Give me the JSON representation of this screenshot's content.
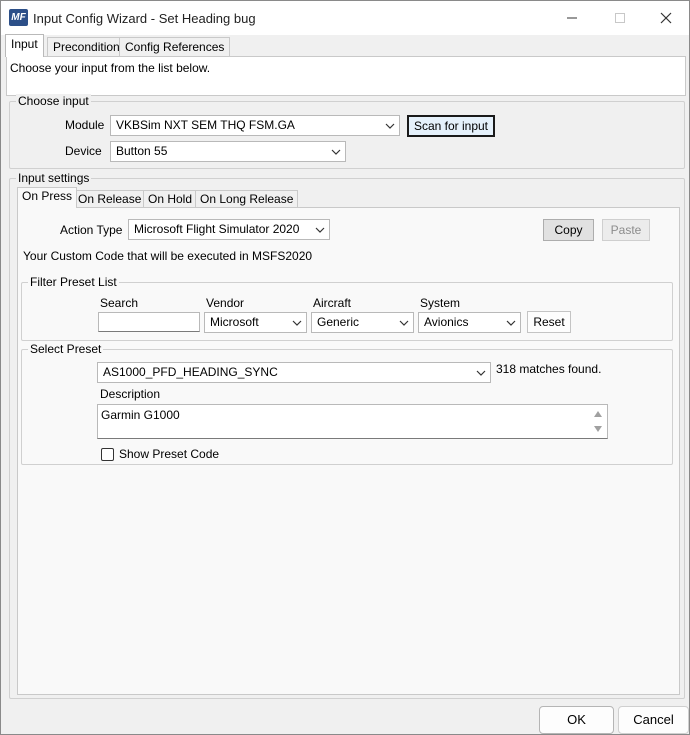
{
  "window": {
    "title": "Input Config Wizard - Set Heading bug",
    "app_icon_text": "MF"
  },
  "tabs": [
    "Input",
    "Precondition",
    "Config References"
  ],
  "instructions": "Choose your input from the list below.",
  "choose_input": {
    "legend": "Choose input",
    "module_label": "Module",
    "module_value": "VKBSim NXT SEM THQ FSM.GA",
    "device_label": "Device",
    "device_value": "Button 55",
    "scan_button": "Scan for input"
  },
  "input_settings": {
    "legend": "Input settings",
    "tabs": [
      "On Press",
      "On Release",
      "On Hold",
      "On Long Release"
    ],
    "action_type_label": "Action Type",
    "action_type_value": "Microsoft Flight Simulator 2020",
    "copy_button": "Copy",
    "paste_button": "Paste",
    "custom_code_note": "Your Custom Code that will be executed in MSFS2020"
  },
  "filter": {
    "legend": "Filter Preset List",
    "search_label": "Search",
    "search_value": "",
    "vendor_label": "Vendor",
    "vendor_value": "Microsoft",
    "aircraft_label": "Aircraft",
    "aircraft_value": "Generic",
    "system_label": "System",
    "system_value": "Avionics",
    "reset_button": "Reset"
  },
  "preset": {
    "legend": "Select Preset",
    "value": "AS1000_PFD_HEADING_SYNC",
    "matches": "318 matches found.",
    "description_label": "Description",
    "description_value": "Garmin G1000",
    "show_code_label": "Show Preset Code",
    "show_code_checked": false
  },
  "footer": {
    "ok_button": "OK",
    "cancel_button": "Cancel"
  }
}
